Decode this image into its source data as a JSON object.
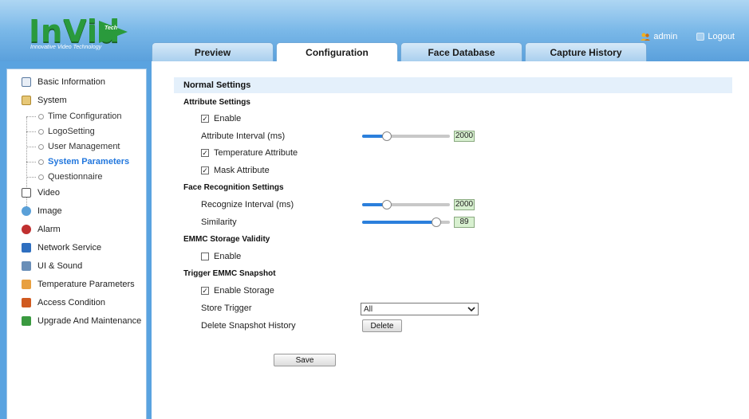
{
  "logo": {
    "main": "InVid",
    "tech": "Tech",
    "tagline": "Innovative Video Technology"
  },
  "user": {
    "name": "admin",
    "logout": "Logout"
  },
  "tabs": [
    {
      "label": "Preview",
      "active": false
    },
    {
      "label": "Configuration",
      "active": true
    },
    {
      "label": "Face Database",
      "active": false
    },
    {
      "label": "Capture History",
      "active": false
    }
  ],
  "sidebar": {
    "items": [
      {
        "label": "Basic Information",
        "icon": "document-icon"
      },
      {
        "label": "System",
        "icon": "folder-icon"
      },
      {
        "label": "Video",
        "icon": "video-icon"
      },
      {
        "label": "Image",
        "icon": "image-icon"
      },
      {
        "label": "Alarm",
        "icon": "alarm-icon"
      },
      {
        "label": "Network Service",
        "icon": "network-icon"
      },
      {
        "label": "UI & Sound",
        "icon": "ui-sound-icon"
      },
      {
        "label": "Temperature Parameters",
        "icon": "temperature-icon"
      },
      {
        "label": "Access Condition",
        "icon": "access-icon"
      },
      {
        "label": "Upgrade And Maintenance",
        "icon": "upgrade-icon"
      }
    ],
    "system_children": [
      {
        "label": "Time Configuration",
        "active": false
      },
      {
        "label": "LogoSetting",
        "active": false
      },
      {
        "label": "User Management",
        "active": false
      },
      {
        "label": "System Parameters",
        "active": true
      },
      {
        "label": "Questionnaire",
        "active": false
      }
    ]
  },
  "main": {
    "section_title": "Normal Settings",
    "attribute": {
      "title": "Attribute Settings",
      "enable_label": "Enable",
      "enable_checked": true,
      "interval_label": "Attribute Interval (ms)",
      "interval_value": "2000",
      "interval_fraction": 0.25,
      "temperature_label": "Temperature Attribute",
      "temperature_checked": true,
      "mask_label": "Mask Attribute",
      "mask_checked": true
    },
    "face": {
      "title": "Face Recognition Settings",
      "recognize_label": "Recognize Interval (ms)",
      "recognize_value": "2000",
      "recognize_fraction": 0.25,
      "similarity_label": "Similarity",
      "similarity_value": "89",
      "similarity_fraction": 0.89
    },
    "emmc": {
      "title": "EMMC Storage Validity",
      "enable_label": "Enable",
      "enable_checked": false
    },
    "snapshot": {
      "title": "Trigger EMMC Snapshot",
      "enable_storage_label": "Enable Storage",
      "enable_storage_checked": true,
      "store_trigger_label": "Store Trigger",
      "store_trigger_value": "All",
      "delete_history_label": "Delete Snapshot History",
      "delete_button": "Delete"
    },
    "save_button": "Save"
  },
  "colors": {
    "accent": "#2b7fdc",
    "active_link": "#2277dd",
    "header": "#5aa0dc",
    "logo_green": "#2a9a3c"
  }
}
